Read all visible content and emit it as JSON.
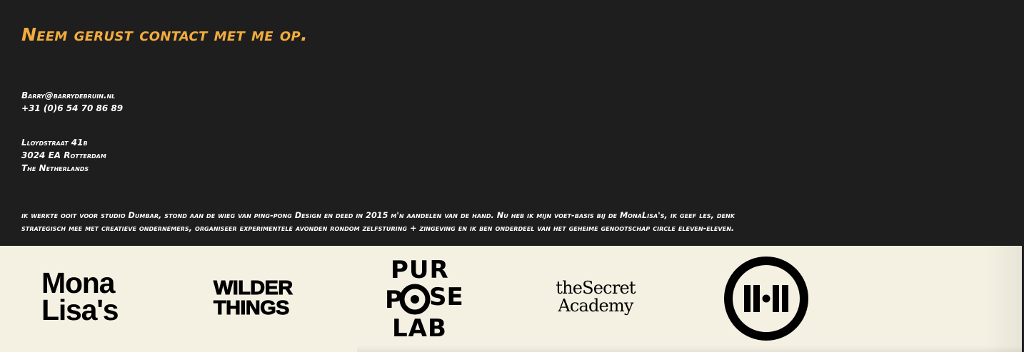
{
  "contact": {
    "heading": "Neem gerust contact met me op.",
    "email": "Barry@barrydebruin.nl",
    "phone": "+31 (0)6 54 70 86 89"
  },
  "address": {
    "street": "Lloydstraat 41b",
    "city": "3024 EA Rotterdam",
    "country": "The Netherlands"
  },
  "bio": {
    "line1": "ik werkte ooit voor studio Dumbar, stond aan de wieg van ping-pong Design en deed in 2015 m'n aandelen van de hand. Nu heb ik mijn voet-basis bij de MonaLisa's, ik geef les, denk",
    "line2": "strategisch mee met creatieve ondernemers, organiseer experimentele avonden rondom zelfsturing + zingeving en ik ben onderdeel van het geheime genootschap circle eleven-eleven."
  },
  "logos": {
    "mona_line1": "Mona",
    "mona_line2": "Lisa's",
    "wilder_line1": "WILDER",
    "wilder_line2": "THINGS",
    "purpose_pur": "PUR",
    "purpose_p": "P",
    "purpose_se": "SE",
    "purpose_lab": "LAB",
    "secret_line1": "theSecret",
    "secret_line2": "Academy",
    "circle_label": "II•II"
  },
  "colors": {
    "accent": "#f2ac3d",
    "background": "#1e1e1e",
    "logo_strip": "#f4f1e3"
  },
  "icons": [
    "purpose-lab-logo",
    "circle-eleven-eleven-logo"
  ]
}
